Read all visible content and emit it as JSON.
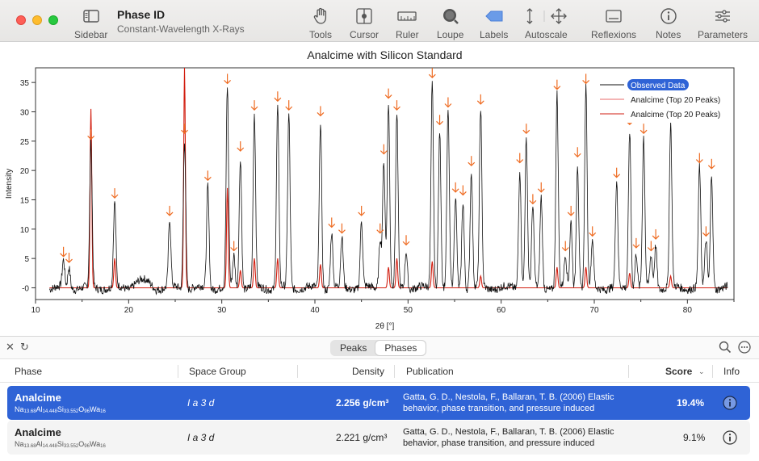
{
  "window": {
    "title": "Phase ID",
    "subtitle": "Constant-Wavelength X-Rays"
  },
  "toolbar": {
    "sidebar": "Sidebar",
    "tools": "Tools",
    "cursor": "Cursor",
    "ruler": "Ruler",
    "loupe": "Loupe",
    "labels": "Labels",
    "autoscale": "Autoscale",
    "reflexions": "Reflexions",
    "notes": "Notes",
    "parameters": "Parameters"
  },
  "chart_data": {
    "type": "line",
    "title": "Analcime with Silicon Standard",
    "xlabel": "2θ [°]",
    "ylabel": "Intensity",
    "xlim": [
      10,
      85
    ],
    "ylim": [
      -2,
      37.5
    ],
    "x_ticks": [
      10,
      20,
      30,
      40,
      50,
      60,
      70,
      80
    ],
    "y_ticks": [
      0,
      5,
      10,
      15,
      20,
      25,
      30,
      35
    ],
    "legend_position": "top-right",
    "legend": [
      "Observed Data",
      "Analcime (Top 20 Peaks)",
      "Analcime (Top 20 Peaks)"
    ],
    "series_colors": {
      "observed": "#111111",
      "calculated": "#d21e10",
      "markers": "#ee6a20"
    },
    "observed_peaks": [
      [
        13.0,
        4.5
      ],
      [
        13.6,
        3.5
      ],
      [
        15.95,
        24.5
      ],
      [
        18.5,
        14.5
      ],
      [
        24.4,
        11.5
      ],
      [
        26.0,
        25.5
      ],
      [
        28.5,
        17.5
      ],
      [
        30.6,
        34
      ],
      [
        31.3,
        5.5
      ],
      [
        32.0,
        22.5
      ],
      [
        33.5,
        29.5
      ],
      [
        36.0,
        31
      ],
      [
        37.2,
        29.5
      ],
      [
        40.6,
        28.5
      ],
      [
        41.8,
        9.5
      ],
      [
        42.9,
        8.5
      ],
      [
        45.0,
        11.5
      ],
      [
        47.0,
        8.5
      ],
      [
        47.4,
        22
      ],
      [
        47.9,
        31.5
      ],
      [
        48.8,
        29.5
      ],
      [
        49.8,
        6.5
      ],
      [
        52.6,
        35
      ],
      [
        53.4,
        27
      ],
      [
        54.3,
        30
      ],
      [
        55.1,
        15.5
      ],
      [
        55.9,
        15
      ],
      [
        56.8,
        20
      ],
      [
        57.8,
        30.5
      ],
      [
        62.0,
        20.5
      ],
      [
        62.7,
        25.5
      ],
      [
        63.4,
        13.5
      ],
      [
        64.3,
        15.5
      ],
      [
        66.0,
        33
      ],
      [
        66.9,
        5.5
      ],
      [
        67.5,
        11.5
      ],
      [
        68.2,
        21.5
      ],
      [
        69.1,
        34
      ],
      [
        69.8,
        8
      ],
      [
        72.4,
        18
      ],
      [
        73.8,
        27
      ],
      [
        74.5,
        6
      ],
      [
        75.3,
        25.5
      ],
      [
        76.1,
        5.5
      ],
      [
        76.6,
        7.5
      ],
      [
        78.2,
        28
      ],
      [
        81.3,
        20.5
      ],
      [
        82.0,
        8
      ],
      [
        82.6,
        19.5
      ]
    ],
    "calculated_peaks": [
      [
        15.95,
        30.5
      ],
      [
        18.5,
        5
      ],
      [
        26.0,
        37.5
      ],
      [
        30.6,
        17
      ],
      [
        32.0,
        3
      ],
      [
        33.5,
        5
      ],
      [
        36.0,
        5
      ],
      [
        40.6,
        4
      ],
      [
        47.9,
        3.5
      ],
      [
        48.8,
        5
      ],
      [
        52.6,
        4.5
      ],
      [
        57.8,
        2
      ],
      [
        66.0,
        3.5
      ],
      [
        69.1,
        3.5
      ],
      [
        73.8,
        2.5
      ],
      [
        78.2,
        2
      ]
    ]
  },
  "lower": {
    "tabs": [
      "Peaks",
      "Phases"
    ],
    "active_tab": "Phases",
    "columns": {
      "phase": "Phase",
      "space_group": "Space Group",
      "density": "Density",
      "publication": "Publication",
      "score": "Score",
      "info": "Info"
    },
    "rows": [
      {
        "name": "Analcime",
        "space_group": "I a 3 d",
        "density": "2.256 g/cm³",
        "publication": "Gatta, G. D., Nestola, F., Ballaran, T. B. (2006) Elastic behavior, phase transition, and pressure induced",
        "score": "19.4%",
        "selected": true
      },
      {
        "name": "Analcime",
        "space_group": "I a 3 d",
        "density": "2.221 g/cm³",
        "publication": "Gatta, G. D., Nestola, F., Ballaran, T. B. (2006) Elastic behavior, phase transition, and pressure induced",
        "score": "9.1%",
        "selected": false
      }
    ]
  }
}
